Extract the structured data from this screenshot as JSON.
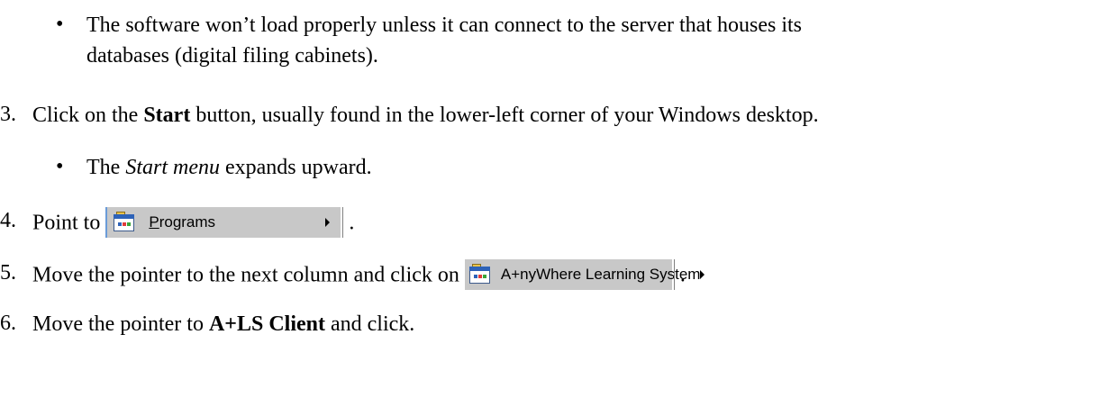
{
  "bullet_a": {
    "line1": "The software won’t load properly unless it can connect to the server that houses its",
    "line2": "databases (digital filing cabinets)."
  },
  "step3": {
    "number": "3.",
    "before": "Click on the ",
    "bold": "Start",
    "after": " button, usually found in the lower-left corner of your Windows desktop."
  },
  "bullet_b": {
    "italic": "Start menu",
    "after": " expands upward.",
    "before": "The "
  },
  "step4": {
    "number": "4.",
    "before": "Point to",
    "menu_label_first": "P",
    "menu_label_rest": "rograms",
    "after": "."
  },
  "step5": {
    "number": "5.",
    "before": "Move the pointer to the next column and click on",
    "menu_label": "A+nyWhere Learning System",
    "after": "."
  },
  "step6": {
    "number": "6.",
    "before": "Move the pointer to ",
    "bold": "A+LS Client",
    "after": " and click."
  },
  "bullet_char": "•",
  "icons": {
    "programs": "program-group-icon",
    "anywhere": "program-group-icon",
    "submenu": "submenu-arrow-icon"
  }
}
